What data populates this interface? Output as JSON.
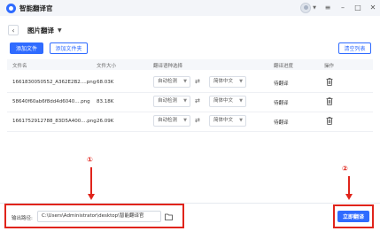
{
  "app": {
    "title": "智能翻译官"
  },
  "page": {
    "title": "图片翻译"
  },
  "toolbar": {
    "add_file": "添加文件",
    "add_folder": "添加文件夹",
    "clear_list": "清空列表"
  },
  "table": {
    "headers": [
      "文件名",
      "文件大小",
      "翻译语种选择",
      "翻译进度",
      "操作"
    ],
    "rows": [
      {
        "name": "1661830050552_A362E2B2....png",
        "size": "68.03K",
        "source": "自动检测",
        "target": "简体中文",
        "status": "待翻译"
      },
      {
        "name": "58640f60ab6f8dd4d6040....png",
        "size": "83.18K",
        "source": "自动检测",
        "target": "简体中文",
        "status": "待翻译"
      },
      {
        "name": "1661752912788_83D5A400....png",
        "size": "26.09K",
        "source": "自动检测",
        "target": "简体中文",
        "status": "待翻译"
      }
    ]
  },
  "footer": {
    "output_label": "输出路径:",
    "output_path": "C:\\Users\\Administrator\\desktop\\智能翻译官",
    "translate_now": "立即翻译"
  },
  "annotations": {
    "marker1": "①",
    "marker2": "②"
  },
  "colors": {
    "accent": "#2f6bff",
    "annotation": "#e0241b"
  }
}
